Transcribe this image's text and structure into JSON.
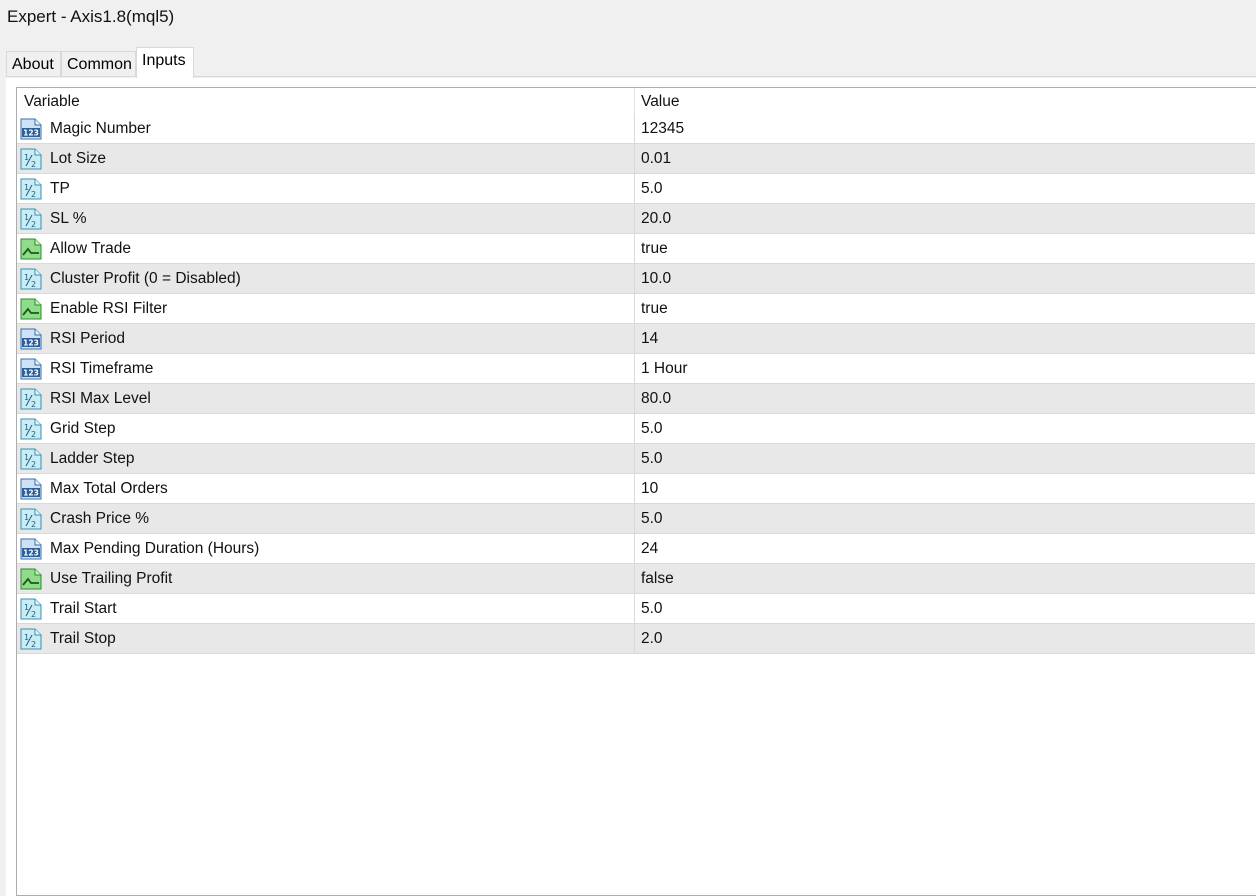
{
  "window": {
    "title": "Expert - Axis1.8(mql5)"
  },
  "tabs": [
    {
      "label": "About"
    },
    {
      "label": "Common"
    },
    {
      "label": "Inputs",
      "active": true
    }
  ],
  "table": {
    "columns": {
      "variable": "Variable",
      "value": "Value"
    },
    "rows": [
      {
        "type": "int",
        "icon": "int-type-icon",
        "name": "Magic Number",
        "value": "12345"
      },
      {
        "type": "double",
        "icon": "double-type-icon",
        "name": "Lot Size",
        "value": "0.01"
      },
      {
        "type": "double",
        "icon": "double-type-icon",
        "name": "TP",
        "value": "5.0"
      },
      {
        "type": "double",
        "icon": "double-type-icon",
        "name": "SL %",
        "value": "20.0"
      },
      {
        "type": "bool",
        "icon": "bool-type-icon",
        "name": "Allow Trade",
        "value": "true"
      },
      {
        "type": "double",
        "icon": "double-type-icon",
        "name": "Cluster Profit (0 = Disabled)",
        "value": "10.0"
      },
      {
        "type": "bool",
        "icon": "bool-type-icon",
        "name": "Enable RSI Filter",
        "value": "true"
      },
      {
        "type": "int",
        "icon": "int-type-icon",
        "name": "RSI Period",
        "value": "14"
      },
      {
        "type": "int",
        "icon": "int-type-icon",
        "name": "RSI Timeframe",
        "value": "1 Hour"
      },
      {
        "type": "double",
        "icon": "double-type-icon",
        "name": "RSI Max Level",
        "value": "80.0"
      },
      {
        "type": "double",
        "icon": "double-type-icon",
        "name": "Grid Step",
        "value": "5.0"
      },
      {
        "type": "double",
        "icon": "double-type-icon",
        "name": "Ladder Step",
        "value": "5.0"
      },
      {
        "type": "int",
        "icon": "int-type-icon",
        "name": "Max Total Orders",
        "value": "10"
      },
      {
        "type": "double",
        "icon": "double-type-icon",
        "name": "Crash Price %",
        "value": "5.0"
      },
      {
        "type": "int",
        "icon": "int-type-icon",
        "name": "Max Pending Duration (Hours)",
        "value": "24"
      },
      {
        "type": "bool",
        "icon": "bool-type-icon",
        "name": "Use Trailing Profit",
        "value": "false"
      },
      {
        "type": "double",
        "icon": "double-type-icon",
        "name": "Trail Start",
        "value": "5.0"
      },
      {
        "type": "double",
        "icon": "double-type-icon",
        "name": "Trail Stop",
        "value": "2.0"
      }
    ]
  }
}
